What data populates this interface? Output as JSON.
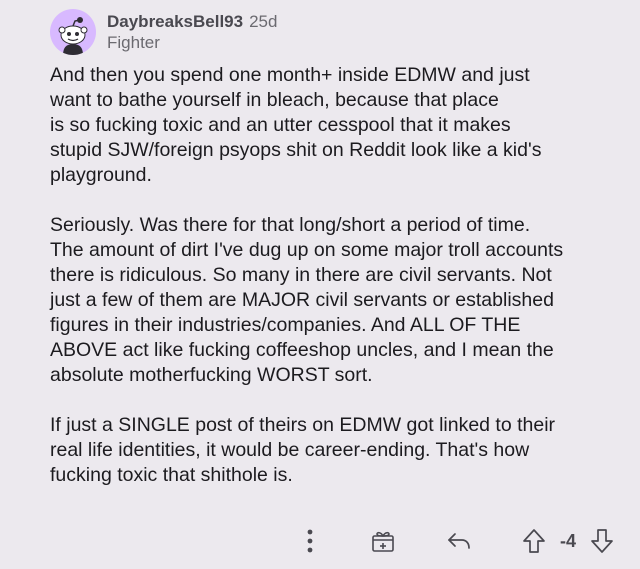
{
  "comment": {
    "author": "DaybreaksBell93",
    "age": "25d",
    "flair": "Fighter",
    "avatar_icon": "snoo-avatar-icon",
    "avatar_color": "#d8b9ff",
    "paragraphs": [
      "And then you spend one month+ inside EDMW and just\nwant to bathe yourself in bleach, because that place\nis so fucking toxic and an utter cesspool that it makes\nstupid SJW/foreign psyops shit on Reddit look like a kid's\nplayground.",
      "Seriously. Was there for that long/short a period of time.\nThe amount of dirt I've dug up on some major troll accounts\nthere is ridiculous. So many in there are civil servants. Not\njust a few of them are MAJOR civil servants or established\nfigures in their industries/companies. And ALL OF THE\nABOVE act like fucking coffeeshop uncles, and I mean the\nabsolute motherfucking WORST sort.",
      "If just a SINGLE post of theirs on EDMW got linked to their\nreal life identities, it would be career-ending. That's how\nfucking toxic that shithole is."
    ],
    "actions": {
      "more_icon": "more-vertical-icon",
      "award_icon": "gift-award-icon",
      "reply_icon": "reply-arrow-icon",
      "upvote_icon": "upvote-arrow-icon",
      "score": "-4",
      "downvote_icon": "downvote-arrow-icon"
    }
  },
  "colors": {
    "background": "#ece9ee",
    "text": "#1c1b1f",
    "muted": "#6b6a70",
    "icon": "#4a4950"
  }
}
